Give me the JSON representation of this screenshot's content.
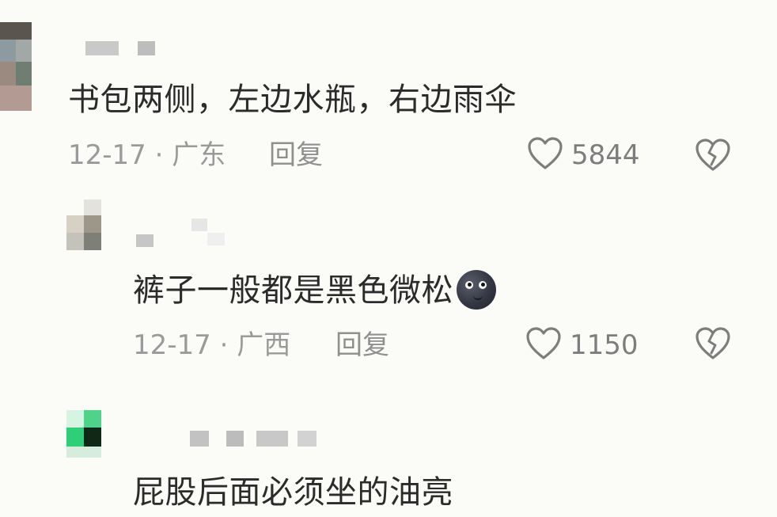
{
  "comments": [
    {
      "text": "书包两侧，左边水瓶，右边雨伞",
      "date_location": "12-17 · 广东",
      "reply_label": "回复",
      "like_count": "5844",
      "avatar_colors": [
        "#6f6a63",
        "#8d9aa0",
        "#a99a8e",
        "#7f8f86"
      ]
    },
    {
      "text": "裤子一般都是黑色微松",
      "emoji": "new-moon-face-emoji",
      "date_location": "12-17 · 广西",
      "reply_label": "回复",
      "like_count": "1150",
      "avatar_colors": [
        "#d8d6cf",
        "#a09a8c",
        "#8a8a80",
        "#e3e1da"
      ]
    },
    {
      "text": "屁股后面必须坐的油亮",
      "avatar_colors": [
        "#2fcf7a",
        "#0c3a1c",
        "#97e6b8",
        "#1d1d1d"
      ]
    }
  ],
  "colors": {
    "background": "#fbfbf8",
    "text": "#2b2b2b",
    "meta": "#9a9a9a",
    "icon": "#7d7d7d"
  },
  "icons": {
    "like": "heart-outline-icon",
    "dislike": "broken-heart-icon"
  }
}
